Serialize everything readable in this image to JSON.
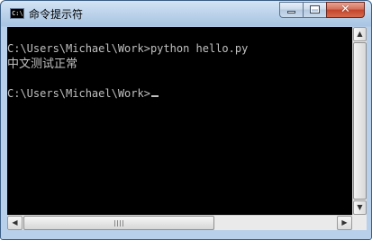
{
  "window": {
    "title": "命令提示符",
    "icon_label": "C:\\",
    "colors": {
      "frame": "#b8d0ea",
      "console_bg": "#000000",
      "console_text": "#c0c0c0",
      "close_button": "#c2442b"
    }
  },
  "caption_buttons": {
    "minimize_glyph": "minimize-icon",
    "maximize_glyph": "maximize-icon",
    "close_glyph": "✕"
  },
  "console": {
    "lines": [
      "",
      "C:\\Users\\Michael\\Work>python hello.py",
      "中文测试正常",
      "",
      "C:\\Users\\Michael\\Work>"
    ]
  },
  "scrollbars": {
    "up_arrow": "▲",
    "down_arrow": "▼",
    "left_arrow": "◀",
    "right_arrow": "▶"
  }
}
